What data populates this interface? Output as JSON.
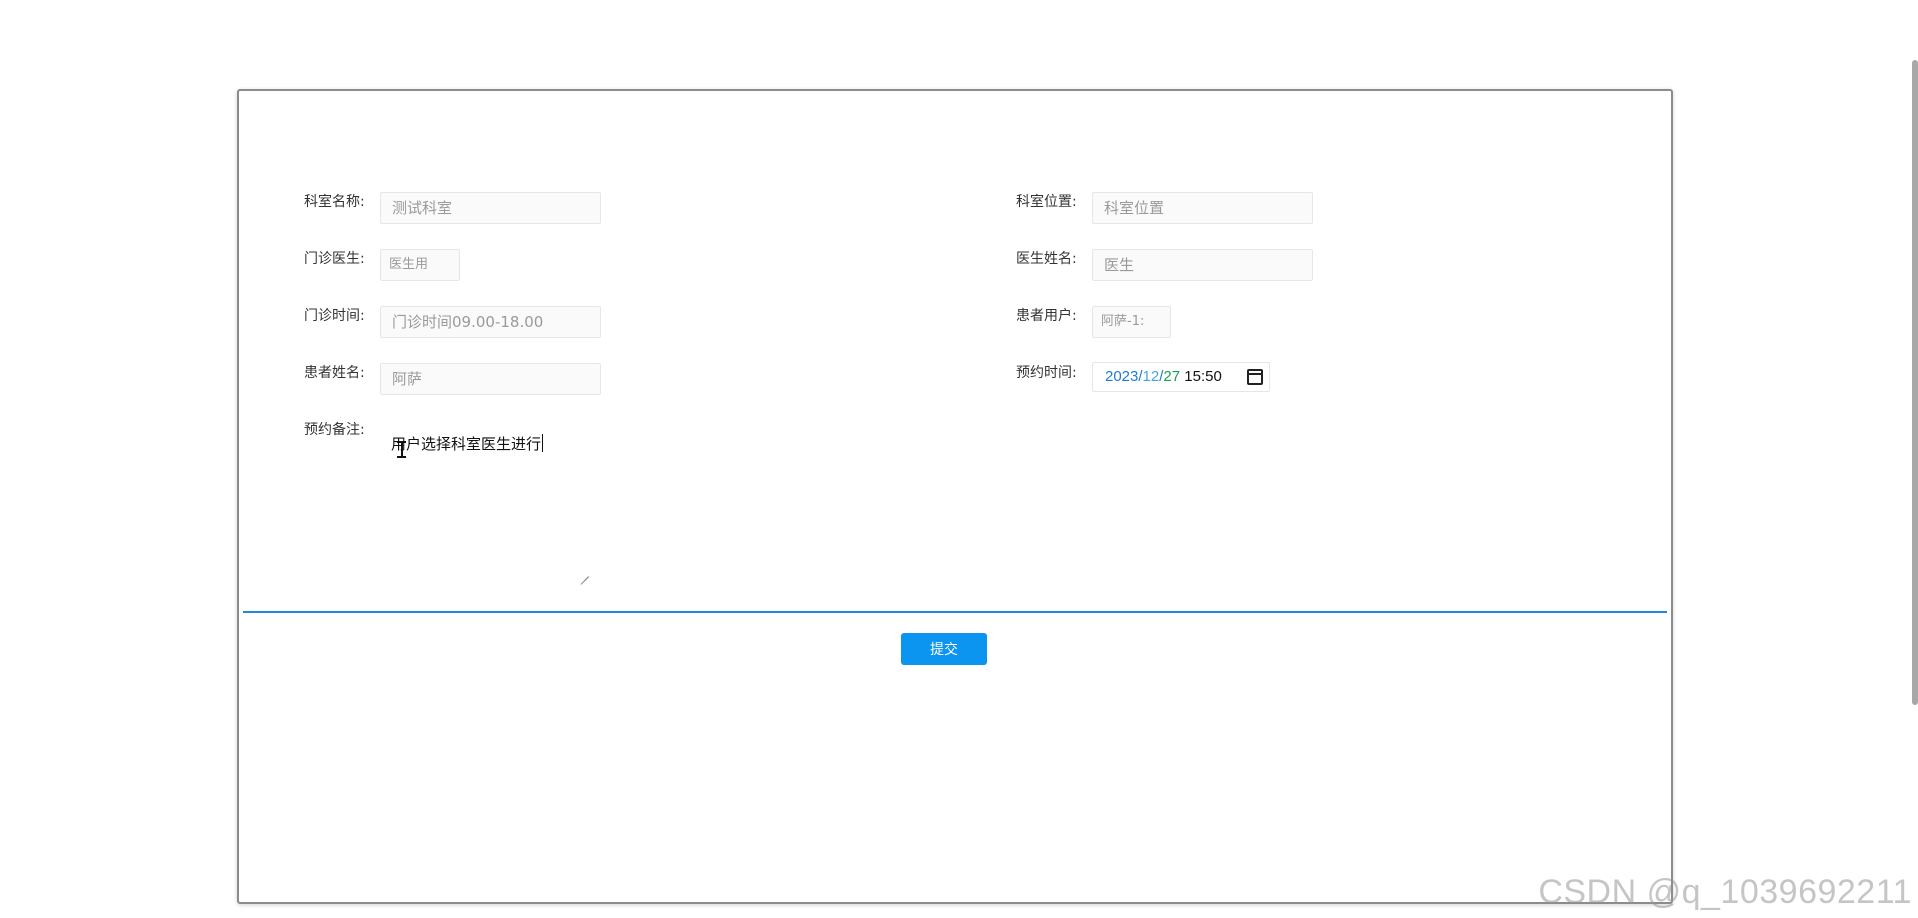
{
  "form": {
    "dept_name": {
      "label": "科室名称:",
      "value": "测试科室"
    },
    "dept_location": {
      "label": "科室位置:",
      "value": "科室位置"
    },
    "clinic_doctor": {
      "label": "门诊医生:",
      "value": "医生用"
    },
    "doctor_name": {
      "label": "医生姓名:",
      "value": "医生"
    },
    "clinic_time": {
      "label": "门诊时间:",
      "value": "门诊时间09.00-18.00"
    },
    "patient_user": {
      "label": "患者用户:",
      "value": "阿萨-1:"
    },
    "patient_name": {
      "label": "患者姓名:",
      "value": "阿萨"
    },
    "appointment_time": {
      "label": "预约时间:",
      "year": "2023",
      "sep1": "/",
      "month": "12",
      "sep2": "/",
      "day": "27",
      "time": "15:50"
    },
    "appointment_note": {
      "label": "预约备注:",
      "value": "用户选择科室医生进行"
    }
  },
  "submit_label": "提交",
  "watermark": "CSDN @q_1039692211",
  "colors": {
    "accent": "#0b94f0",
    "divider": "#1e88e5"
  }
}
